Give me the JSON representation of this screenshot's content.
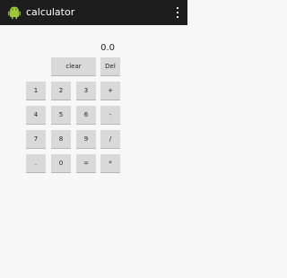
{
  "app": {
    "title": "calculator",
    "icon": "android-icon",
    "menu_icon": "overflow-menu-icon"
  },
  "display": {
    "value": "0.0"
  },
  "keys": {
    "clear": "clear",
    "del": "Del",
    "one": "1",
    "two": "2",
    "three": "3",
    "plus": "+",
    "four": "4",
    "five": "5",
    "six": "6",
    "minus": "-",
    "seven": "7",
    "eight": "8",
    "nine": "9",
    "divide": "/",
    "dot": ".",
    "zero": "0",
    "equals": "=",
    "multiply": "*"
  },
  "colors": {
    "action_bar": "#1d1d1d",
    "background": "#f7f7f7",
    "button": "#d9d9d9",
    "android_green": "#9fc73c"
  }
}
